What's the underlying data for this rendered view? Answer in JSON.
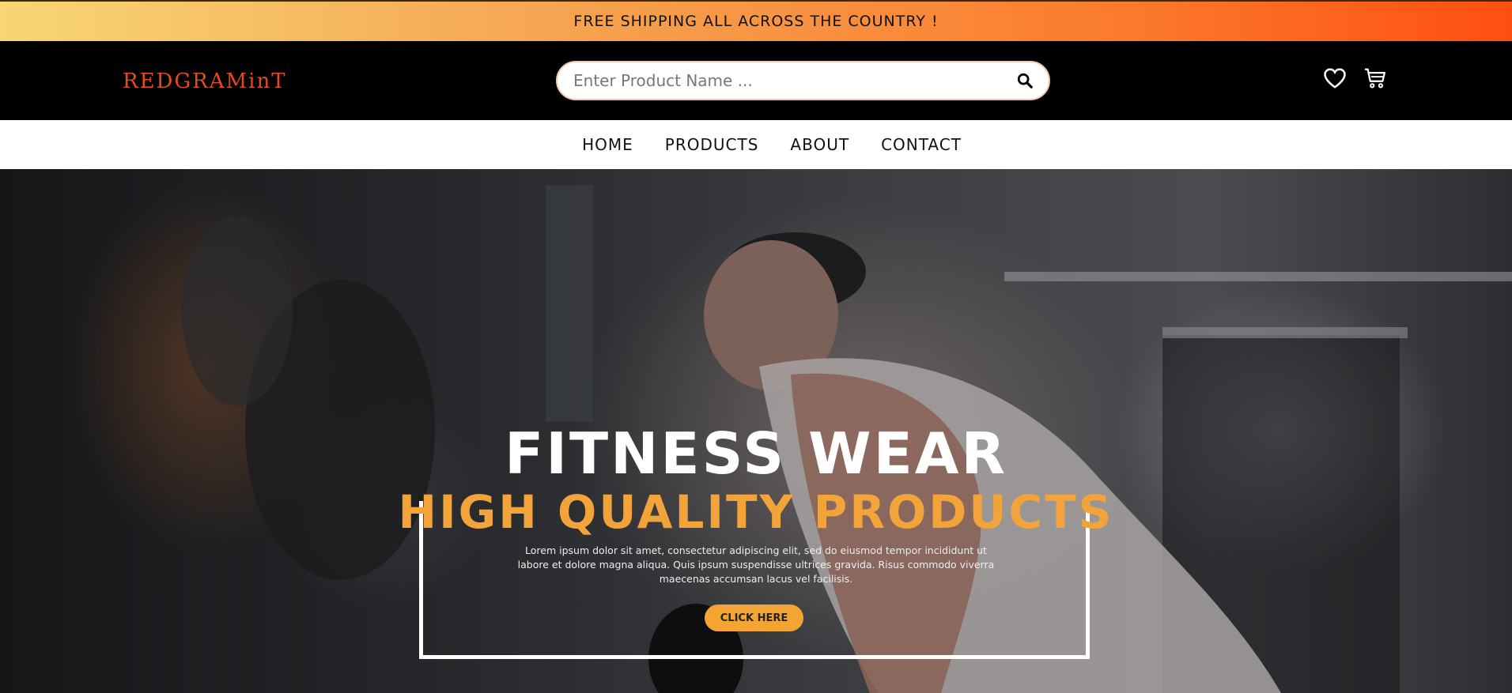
{
  "promo": {
    "text": "FREE SHIPPING ALL ACROSS THE COUNTRY !"
  },
  "header": {
    "logo": "REDGRAMinT",
    "search": {
      "placeholder": "Enter Product Name ...",
      "value": "",
      "icon": "search-icon"
    },
    "icons": {
      "wishlist": "heart-icon",
      "cart": "cart-icon"
    }
  },
  "nav": {
    "items": [
      {
        "label": "HOME"
      },
      {
        "label": "PRODUCTS"
      },
      {
        "label": "ABOUT"
      },
      {
        "label": "CONTACT"
      }
    ]
  },
  "hero": {
    "title": "FITNESS WEAR",
    "subtitle": "HIGH QUALITY PRODUCTS",
    "description": "Lorem ipsum dolor sit amet, consectetur adipiscing elit, sed do eiusmod tempor incididunt ut labore et dolore magna aliqua. Quis ipsum suspendisse ultrices gravida. Risus commodo viverra maecenas accumsan lacus vel facilisis.",
    "button_label": "CLICK HERE"
  },
  "colors": {
    "accent": "#f4a433",
    "logo": "#e64a1e",
    "promo_gradient_start": "#f7d676",
    "promo_gradient_end": "#ff4e12"
  }
}
